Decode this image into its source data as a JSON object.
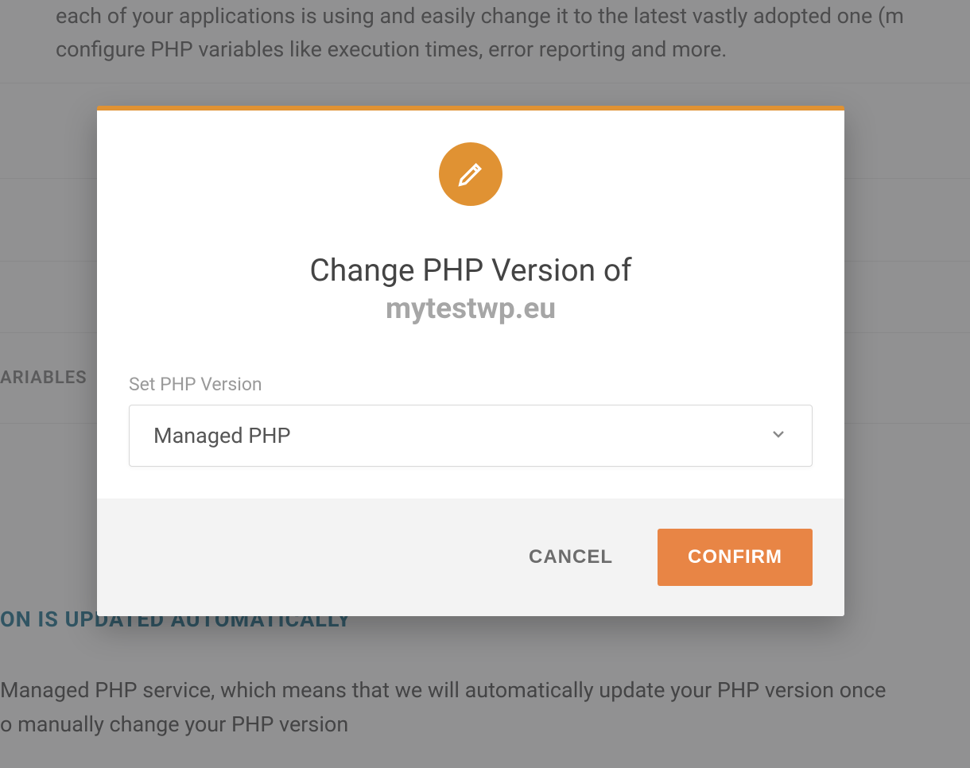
{
  "background": {
    "intro_line1": "each of your applications is using and easily change it to the latest vastly adopted one (m",
    "intro_line2": "configure PHP variables like execution times, error reporting and more.",
    "tab_label": "ARIABLES",
    "bottom_heading": "ON IS UPDATED AUTOMATICALLY",
    "bottom_para_line1": " Managed PHP service, which means that we will automatically update your PHP version once",
    "bottom_para_line2": "o manually change your PHP version"
  },
  "modal": {
    "title": "Change PHP Version of",
    "subtitle": "mytestwp.eu",
    "field_label": "Set PHP Version",
    "select_value": "Managed PHP",
    "cancel_label": "CANCEL",
    "confirm_label": "CONFIRM"
  }
}
